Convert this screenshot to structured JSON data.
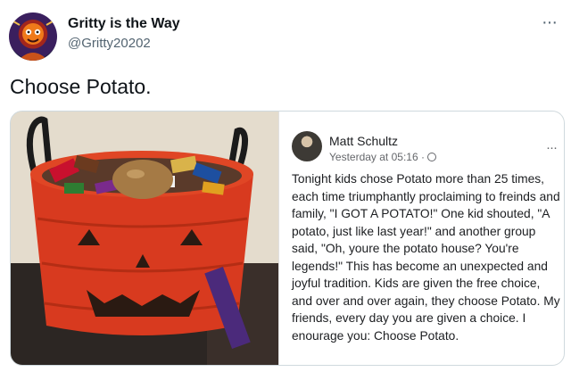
{
  "user": {
    "display_name": "Gritty is the Way",
    "handle": "@Gritty20202",
    "avatar_icon": "gritty-avatar-icon"
  },
  "tweet": {
    "text": "Choose Potato."
  },
  "embedded_post": {
    "author": "Matt Schultz",
    "timestamp": "Yesterday at 05:16 ·",
    "body": "Tonight kids chose Potato more than 25 times, each time triumphantly proclaiming to freinds and family, \"I GOT A POTATO!\" One kid shouted, \"A potato, just like last year!\" and another group said, \"Oh, youre the potato house? You're legends!\" This has become an unexpected and joyful tradition. Kids are given the free choice, and over and over again, they choose Potato. My friends, every day you are given a choice. I enourage you: Choose Potato."
  },
  "colors": {
    "text_primary": "#0f1419",
    "text_secondary": "#536471",
    "border": "#cfd9de",
    "bucket": "#d83a1f"
  }
}
